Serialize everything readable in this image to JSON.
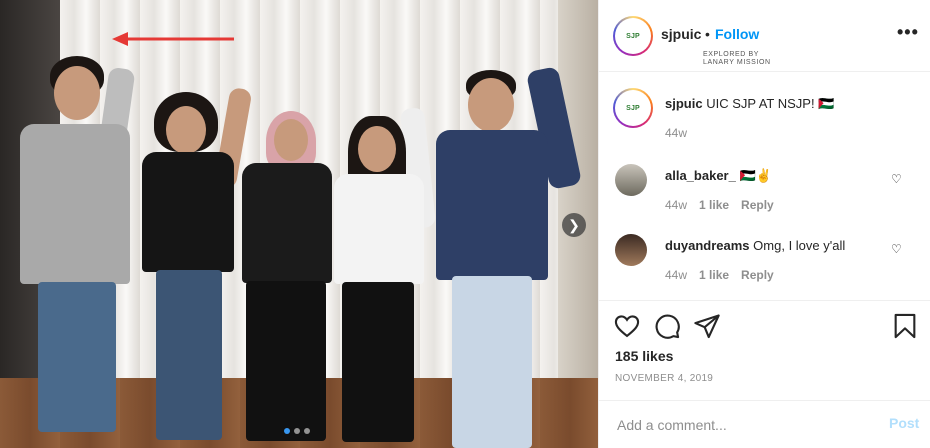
{
  "account": {
    "username": "sjpuic",
    "separator": "•",
    "follow_label": "Follow",
    "subtitle_line1": "EXPLORED BY",
    "subtitle_line2": "LANARY MISSION",
    "more_icon": "more-horizontal-icon",
    "logo_text": "SJP"
  },
  "caption": {
    "username": "sjpuic",
    "text": "UIC SJP AT NSJP! 🇵🇸",
    "age": "44w"
  },
  "comments": [
    {
      "username": "alla_baker_",
      "text": "🇵🇸✌",
      "age": "44w",
      "likes": "1 like",
      "reply_label": "Reply"
    },
    {
      "username": "duyandreams",
      "text": "Omg, I love y'all",
      "age": "44w",
      "likes": "1 like",
      "reply_label": "Reply"
    }
  ],
  "actions": {
    "icons": [
      "heart-icon",
      "comment-icon",
      "share-icon",
      "bookmark-icon"
    ],
    "likes_count": "185 likes",
    "date": "NOVEMBER 4, 2019"
  },
  "composer": {
    "placeholder": "Add a comment...",
    "post_label": "Post"
  },
  "carousel": {
    "slide_count": 3,
    "active_index": 0,
    "next_icon": "chevron-right-icon"
  },
  "colors": {
    "follow": "#0095f6",
    "post_disabled": "#b2dffc",
    "text": "#262626",
    "muted": "#8e8e8e",
    "arrow": "#e53935"
  }
}
